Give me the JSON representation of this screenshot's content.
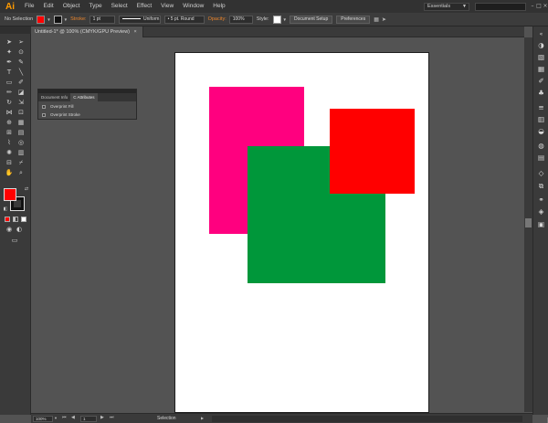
{
  "app": {
    "logo": "Ai"
  },
  "menu": [
    "File",
    "Edit",
    "Object",
    "Type",
    "Select",
    "Effect",
    "View",
    "Window",
    "Help"
  ],
  "workspace": {
    "label": "Essentials"
  },
  "control_bar": {
    "selection_label": "No Selection",
    "fill_color": "#ff0000",
    "stroke_label": "Stroke:",
    "stroke_weight": "1 pt",
    "profile_label": "Uniform",
    "brush_label": "5 pt. Round",
    "opacity_label": "Opacity:",
    "opacity_value": "100%",
    "style_label": "Style:",
    "document_setup": "Document Setup",
    "preferences": "Preferences"
  },
  "document_tab": {
    "title": "Untitled-1* @ 100% (CMYK/GPU Preview)",
    "close": "×"
  },
  "panel": {
    "tabs": [
      "Document Info",
      "C Attributes"
    ],
    "rows": [
      "Overprint Fill",
      "Overprint Stroke"
    ]
  },
  "shapes": [
    {
      "name": "pink-rectangle",
      "color": "#ff007f"
    },
    {
      "name": "green-rectangle",
      "color": "#00973a"
    },
    {
      "name": "red-rectangle",
      "color": "#ff0000"
    }
  ],
  "status_bar": {
    "zoom": "100%",
    "page": "1",
    "tool": "Selection"
  }
}
